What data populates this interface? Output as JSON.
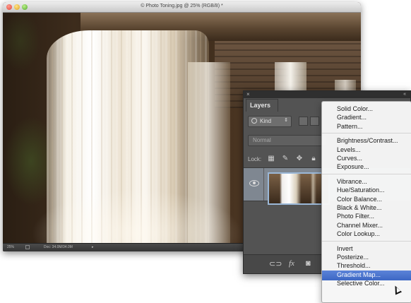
{
  "document": {
    "title": "© Photo Toning.jpg @ 25% (RGB/8) *",
    "status_zoom": "25%",
    "status_info": "Doc: 34.0M/34.0M",
    "status_arrow": "▸"
  },
  "layers_panel": {
    "tab_label": "Layers",
    "kind_label": "Kind",
    "blend_mode": "Normal",
    "lock_label": "Lock:",
    "close_glyph": "×",
    "collapse_glyph": "«",
    "footer_icons": [
      "link-icon",
      "fx-icon",
      "mask-icon"
    ],
    "footer_link": "⊂⊃",
    "footer_fx": "fx",
    "footer_mask": "◙"
  },
  "adjustment_menu": {
    "groups": [
      [
        "Solid Color...",
        "Gradient...",
        "Pattern..."
      ],
      [
        "Brightness/Contrast...",
        "Levels...",
        "Curves...",
        "Exposure..."
      ],
      [
        "Vibrance...",
        "Hue/Saturation...",
        "Color Balance...",
        "Black & White...",
        "Photo Filter...",
        "Channel Mixer...",
        "Color Lookup..."
      ],
      [
        "Invert",
        "Posterize...",
        "Threshold...",
        "Gradient Map...",
        "Selective Color..."
      ]
    ],
    "selected": "Gradient Map...",
    "highlight_color": "#3d67c4"
  }
}
